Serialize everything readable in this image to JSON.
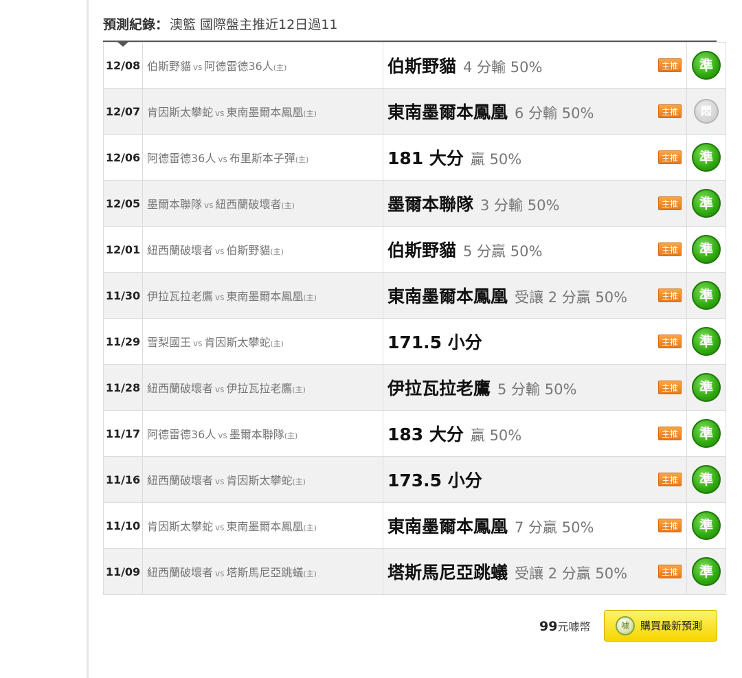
{
  "header": {
    "label": "預測紀錄：",
    "text": "澳籃 國際盤主推近12日過11"
  },
  "rows": [
    {
      "date": "12/08",
      "away": "伯斯野貓",
      "vs": "vs",
      "home": "阿德雷德36人",
      "home_mark": "(主)",
      "pick": "伯斯野貓",
      "detail": "4 分輸 50%",
      "badge": "主推",
      "result": "準",
      "status": "win",
      "alt": false
    },
    {
      "date": "12/07",
      "away": "肯因斯太攀蛇",
      "vs": "vs",
      "home": "東南墨爾本鳳凰",
      "home_mark": "(主)",
      "pick": "東南墨爾本鳳凰",
      "detail": "6 分輸 50%",
      "badge": "主推",
      "result": "悶",
      "status": "pending",
      "alt": true
    },
    {
      "date": "12/06",
      "away": "阿德雷德36人",
      "vs": "vs",
      "home": "布里斯本子彈",
      "home_mark": "(主)",
      "pick": "181 大分",
      "detail": "贏 50%",
      "badge": "主推",
      "result": "準",
      "status": "win",
      "alt": false
    },
    {
      "date": "12/05",
      "away": "墨爾本聯隊",
      "vs": "vs",
      "home": "紐西蘭破壞者",
      "home_mark": "(主)",
      "pick": "墨爾本聯隊",
      "detail": "3 分輸 50%",
      "badge": "主推",
      "result": "準",
      "status": "win",
      "alt": true
    },
    {
      "date": "12/01",
      "away": "紐西蘭破壞者",
      "vs": "vs",
      "home": "伯斯野貓",
      "home_mark": "(主)",
      "pick": "伯斯野貓",
      "detail": "5 分贏 50%",
      "badge": "主推",
      "result": "準",
      "status": "win",
      "alt": false
    },
    {
      "date": "11/30",
      "away": "伊拉瓦拉老鷹",
      "vs": "vs",
      "home": "東南墨爾本鳳凰",
      "home_mark": "(主)",
      "pick": "東南墨爾本鳳凰",
      "detail": "受讓 2 分贏 50%",
      "badge": "主推",
      "result": "準",
      "status": "win",
      "alt": true
    },
    {
      "date": "11/29",
      "away": "雪梨國王",
      "vs": "vs",
      "home": "肯因斯太攀蛇",
      "home_mark": "(主)",
      "pick": "171.5 小分",
      "detail": "",
      "badge": "主推",
      "result": "準",
      "status": "win",
      "alt": false
    },
    {
      "date": "11/28",
      "away": "紐西蘭破壞者",
      "vs": "vs",
      "home": "伊拉瓦拉老鷹",
      "home_mark": "(主)",
      "pick": "伊拉瓦拉老鷹",
      "detail": "5 分輸 50%",
      "badge": "主推",
      "result": "準",
      "status": "win",
      "alt": true
    },
    {
      "date": "11/17",
      "away": "阿德雷德36人",
      "vs": "vs",
      "home": "墨爾本聯隊",
      "home_mark": "(主)",
      "pick": "183 大分",
      "detail": "贏 50%",
      "badge": "主推",
      "result": "準",
      "status": "win",
      "alt": false
    },
    {
      "date": "11/16",
      "away": "紐西蘭破壞者",
      "vs": "vs",
      "home": "肯因斯太攀蛇",
      "home_mark": "(主)",
      "pick": "173.5 小分",
      "detail": "",
      "badge": "主推",
      "result": "準",
      "status": "win",
      "alt": true
    },
    {
      "date": "11/10",
      "away": "肯因斯太攀蛇",
      "vs": "vs",
      "home": "東南墨爾本鳳凰",
      "home_mark": "(主)",
      "pick": "東南墨爾本鳳凰",
      "detail": "7 分贏 50%",
      "badge": "主推",
      "result": "準",
      "status": "win",
      "alt": false
    },
    {
      "date": "11/09",
      "away": "紐西蘭破壞者",
      "vs": "vs",
      "home": "塔斯馬尼亞跳蟻",
      "home_mark": "(主)",
      "pick": "塔斯馬尼亞跳蟻",
      "detail": "受讓 2 分贏 50%",
      "badge": "主推",
      "result": "準",
      "status": "win",
      "alt": true
    }
  ],
  "purchase": {
    "price": "99",
    "unit": "元噱幣",
    "coin_icon": "coin-icon",
    "coin_glyph": "噱",
    "button_label": "購買最新預測"
  }
}
